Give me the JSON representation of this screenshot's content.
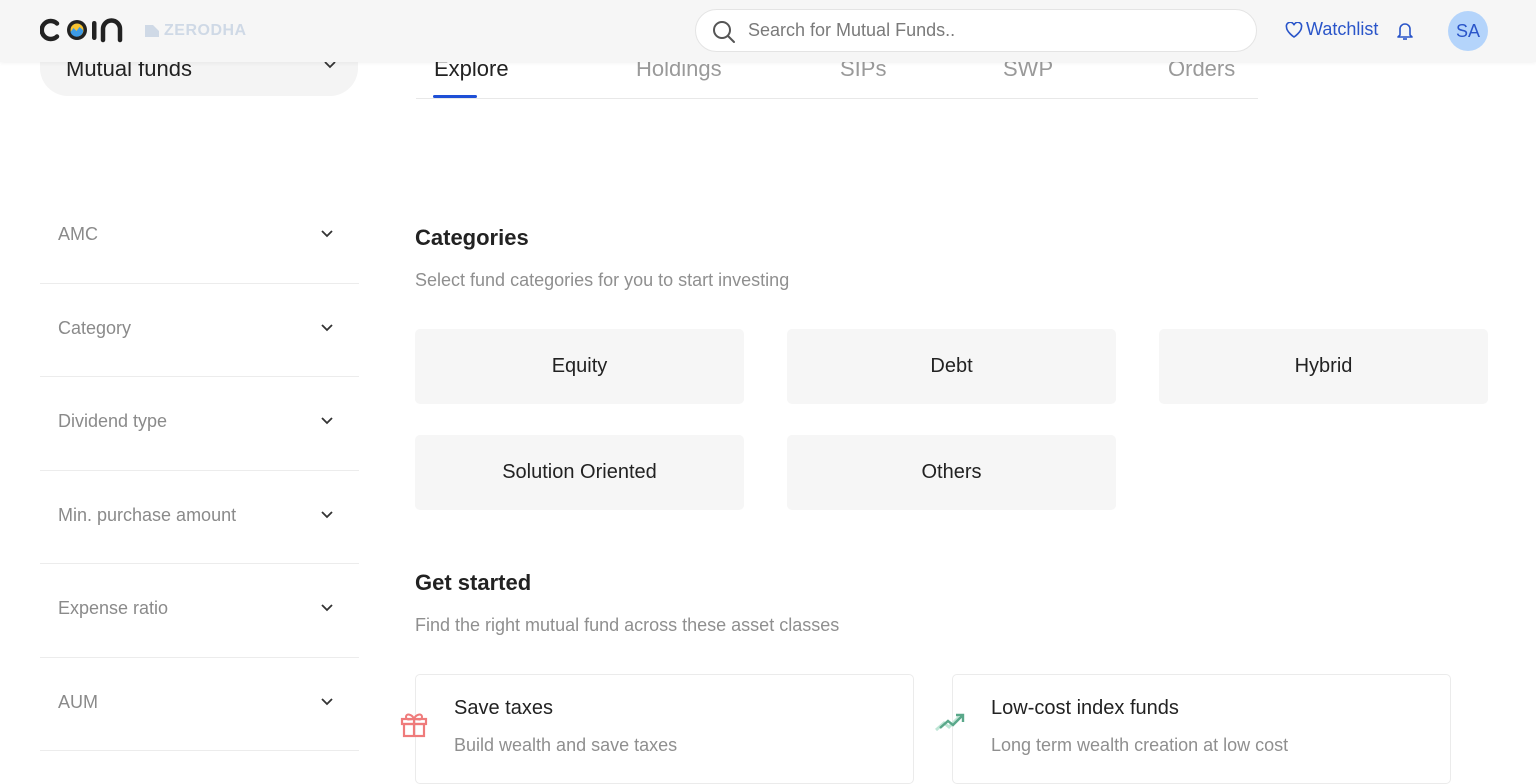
{
  "header": {
    "logo_text": "coin",
    "brand_text": "ZERODHA",
    "search_placeholder": "Search for Mutual Funds..",
    "search_value": "",
    "watchlist_label": "Watchlist",
    "avatar_initials": "SA",
    "accent_color": "#2a55c9"
  },
  "product_selector": {
    "label": "Mutual funds"
  },
  "tabs": [
    {
      "label": "Explore",
      "active": true
    },
    {
      "label": "Holdings",
      "active": false
    },
    {
      "label": "SIPs",
      "active": false
    },
    {
      "label": "SWP",
      "active": false
    },
    {
      "label": "Orders",
      "active": false
    }
  ],
  "filters": [
    {
      "label": "AMC"
    },
    {
      "label": "Category"
    },
    {
      "label": "Dividend type"
    },
    {
      "label": "Min. purchase amount"
    },
    {
      "label": "Expense ratio"
    },
    {
      "label": "AUM"
    }
  ],
  "categories": {
    "title": "Categories",
    "subtitle": "Select fund categories for you to start investing",
    "items": [
      {
        "label": "Equity"
      },
      {
        "label": "Debt"
      },
      {
        "label": "Hybrid"
      },
      {
        "label": "Solution Oriented"
      },
      {
        "label": "Others"
      }
    ]
  },
  "get_started": {
    "title": "Get started",
    "subtitle": "Find the right mutual fund across these asset classes",
    "cards": [
      {
        "icon": "gift-icon",
        "title": "Save taxes",
        "subtitle": "Build wealth and save taxes",
        "icon_color": "#ef7b7b"
      },
      {
        "icon": "trending-up-icon",
        "title": "Low-cost index funds",
        "subtitle": "Long term wealth creation at low cost",
        "icon_color": "#5aa88a"
      }
    ]
  }
}
